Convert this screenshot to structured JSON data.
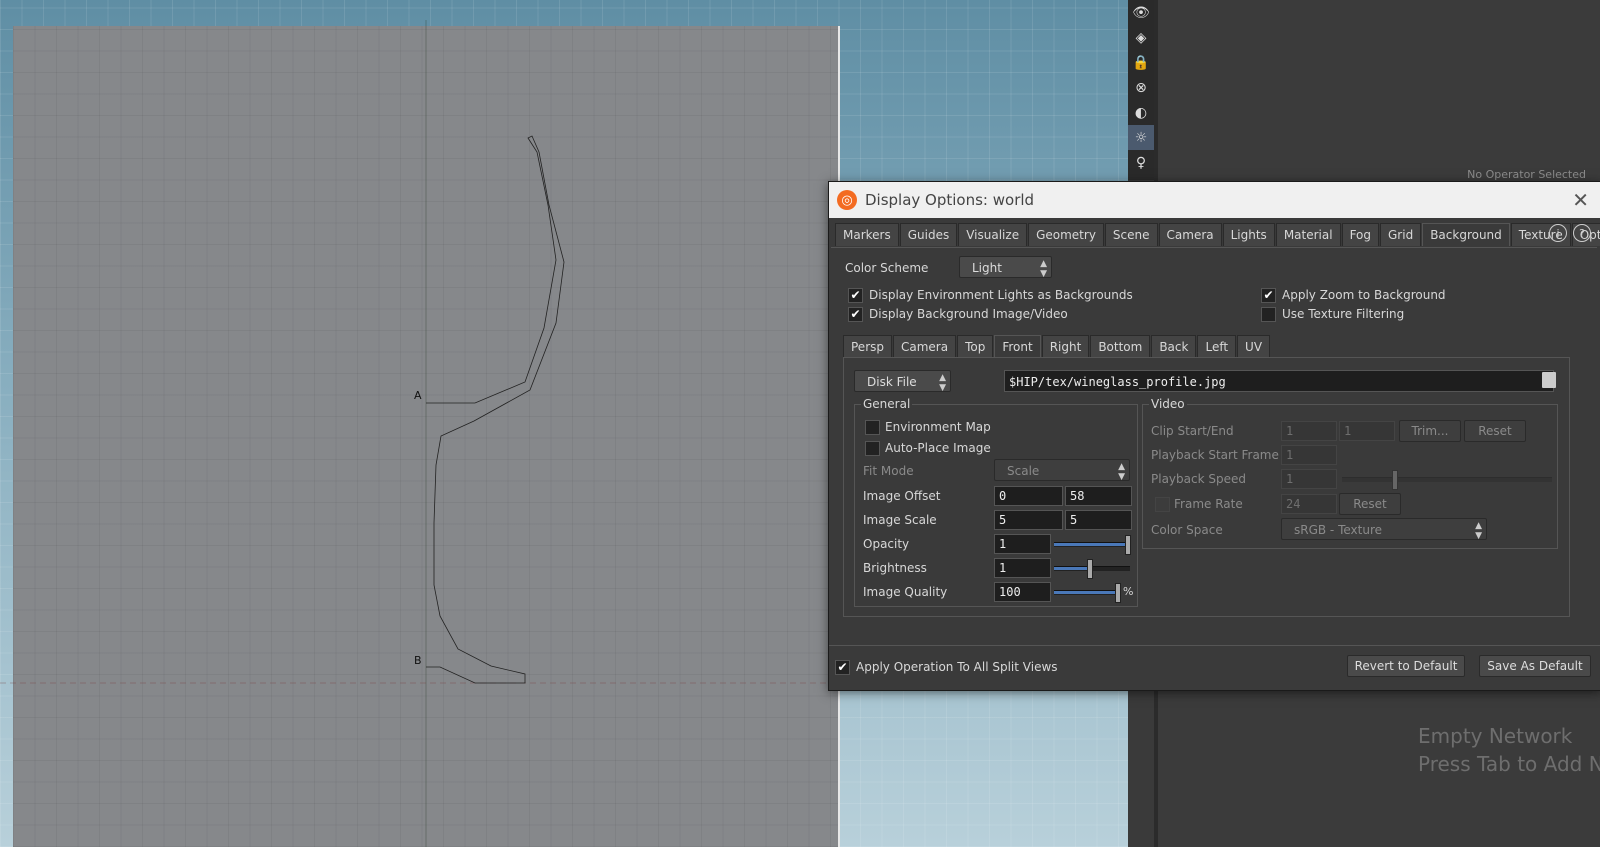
{
  "viewport": {
    "point_labels": [
      "A",
      "B"
    ]
  },
  "tool_strip": {
    "icons": [
      "eye-icon",
      "view-icon",
      "lock-icon",
      "ghost-icon",
      "shading-icon",
      "light-icon",
      "camera-light-icon",
      "snapshot-icon"
    ]
  },
  "network": {
    "no_operator": "No Operator Selected",
    "empty_line1": "Empty Network",
    "empty_line2": "Press Tab to Add Node"
  },
  "dialog": {
    "title": "Display Options:  world",
    "tabs": [
      "Markers",
      "Guides",
      "Visualize",
      "Geometry",
      "Scene",
      "Camera",
      "Lights",
      "Material",
      "Fog",
      "Grid",
      "Background",
      "Texture",
      "Optimize"
    ],
    "active_tab": "Background",
    "color_scheme_label": "Color Scheme",
    "color_scheme_value": "Light",
    "env_lights_label": "Display Environment Lights as Backgrounds",
    "bg_image_label": "Display Background Image/Video",
    "apply_zoom_label": "Apply Zoom to Background",
    "texture_filter_label": "Use Texture Filtering",
    "view_tabs": [
      "Persp",
      "Camera",
      "Top",
      "Front",
      "Right",
      "Bottom",
      "Back",
      "Left",
      "UV"
    ],
    "active_view": "Front",
    "source_value": "Disk File",
    "file_path": "$HIP/tex/wineglass_profile.jpg",
    "general": {
      "title": "General",
      "env_map_label": "Environment Map",
      "auto_place_label": "Auto-Place Image",
      "fit_mode_label": "Fit Mode",
      "fit_mode_value": "Scale",
      "image_offset_label": "Image Offset",
      "image_offset_x": "0",
      "image_offset_y": "58",
      "image_scale_label": "Image Scale",
      "image_scale_x": "5",
      "image_scale_y": "5",
      "opacity_label": "Opacity",
      "opacity_value": "1",
      "opacity_level": 1.0,
      "brightness_label": "Brightness",
      "brightness_value": "1",
      "brightness_level": 0.5,
      "quality_label": "Image Quality",
      "quality_value": "100",
      "quality_level": 1.0,
      "quality_unit": "%"
    },
    "video": {
      "title": "Video",
      "clip_label": "Clip Start/End",
      "clip_start": "1",
      "clip_end": "1",
      "trim_label": "Trim...",
      "reset_label": "Reset",
      "playback_start_label": "Playback Start Frame",
      "playback_start_value": "1",
      "playback_speed_label": "Playback Speed",
      "playback_speed_value": "1",
      "frame_rate_label": "Frame Rate",
      "frame_rate_value": "24",
      "frame_rate_reset": "Reset",
      "color_space_label": "Color Space",
      "color_space_value": "sRGB - Texture"
    },
    "apply_all_label": "Apply Operation To All Split Views",
    "revert_label": "Revert to Default",
    "save_label": "Save As Default"
  }
}
